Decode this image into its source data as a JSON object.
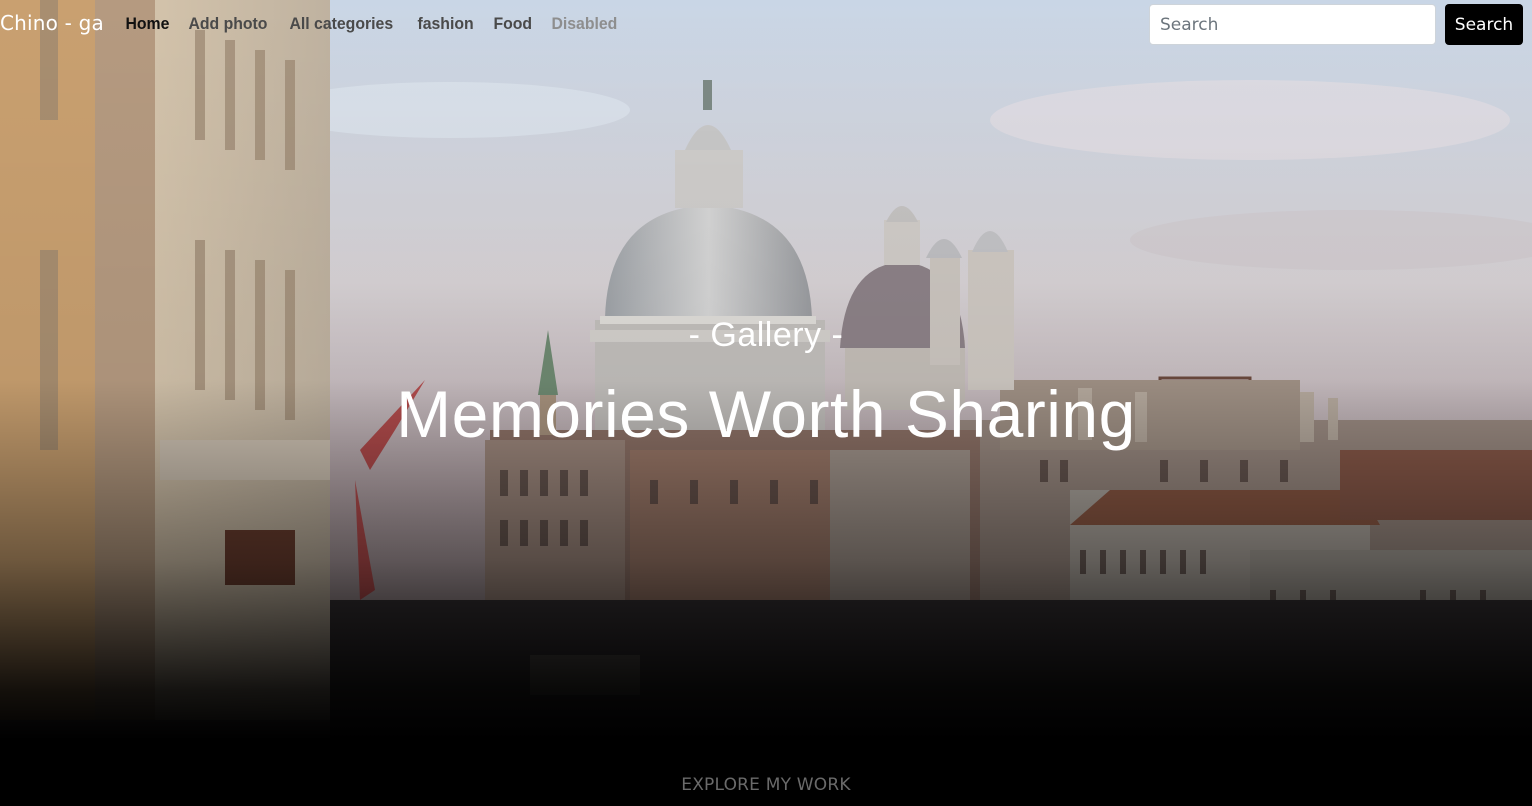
{
  "brand": "Chino - ga",
  "nav": {
    "items": [
      {
        "label": "Home",
        "state": "active"
      },
      {
        "label": "Add photo",
        "state": "normal"
      },
      {
        "label": "All categories",
        "state": "normal"
      },
      {
        "label": "fashion",
        "state": "normal"
      },
      {
        "label": "Food",
        "state": "normal"
      },
      {
        "label": "Disabled",
        "state": "disabled"
      }
    ]
  },
  "search": {
    "placeholder": "Search",
    "button_label": "Search"
  },
  "hero": {
    "kicker": "- Gallery -",
    "title": "Memories Worth Sharing",
    "cta": "EXPLORE MY WORK",
    "background_image": "venice-grand-canal-photo"
  },
  "colors": {
    "nav_active": "#111111",
    "nav_default": "#4a4a4a",
    "nav_disabled": "#8e8e8e",
    "button": "#000000"
  }
}
